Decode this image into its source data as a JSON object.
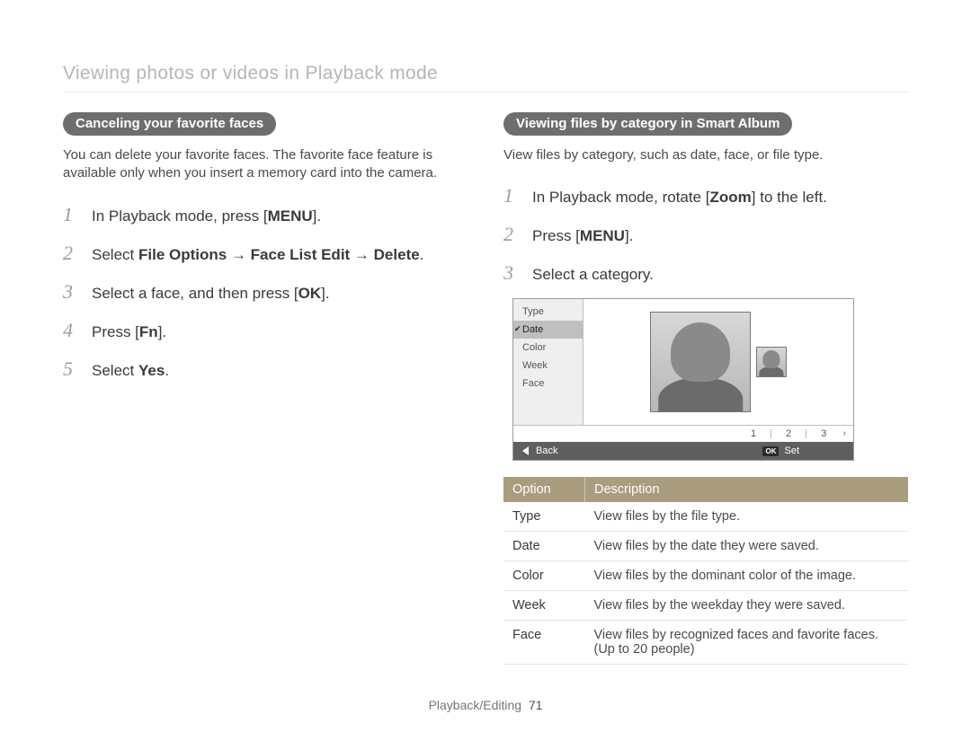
{
  "page_title": "Viewing photos or videos in Playback mode",
  "left": {
    "heading": "Canceling your favorite faces",
    "intro": "You can delete your favorite faces. The favorite face feature is available only when you insert a memory card into the camera.",
    "steps": {
      "s1_a": "In Playback mode, press [",
      "s1_btn": "MENU",
      "s1_b": "].",
      "s2_a": "Select ",
      "s2_b1": "File Options",
      "s2_arrow1": " → ",
      "s2_b2": "Face List Edit",
      "s2_arrow2": " → ",
      "s2_b3": "Delete",
      "s2_c": ".",
      "s3_a": "Select a face, and then press [",
      "s3_btn": "OK",
      "s3_b": "].",
      "s4_a": "Press [",
      "s4_btn": "Fn",
      "s4_b": "].",
      "s5_a": "Select ",
      "s5_b": "Yes",
      "s5_c": "."
    }
  },
  "right": {
    "heading": "Viewing files by category in Smart Album",
    "intro": "View files by category, such as date, face, or file type.",
    "steps": {
      "s1_a": "In Playback mode, rotate [",
      "s1_btn": "Zoom",
      "s1_b": "] to the left.",
      "s2_a": "Press [",
      "s2_btn": "MENU",
      "s2_b": "].",
      "s3": "Select a category."
    },
    "screen": {
      "side": [
        "Type",
        "Date",
        "Color",
        "Week",
        "Face"
      ],
      "nums": [
        "1",
        "2",
        "3"
      ],
      "back": "Back",
      "set": "Set",
      "ok": "OK"
    },
    "table": {
      "h1": "Option",
      "h2": "Description",
      "rows": [
        {
          "opt": "Type",
          "desc": "View files by the file type."
        },
        {
          "opt": "Date",
          "desc": "View files by the date they were saved."
        },
        {
          "opt": "Color",
          "desc": "View files by the dominant color of the image."
        },
        {
          "opt": "Week",
          "desc": "View files by the weekday they were saved."
        },
        {
          "opt": "Face",
          "desc": "View files by recognized faces and favorite faces. (Up to 20 people)"
        }
      ]
    }
  },
  "footer": {
    "section": "Playback/Editing",
    "page": "71"
  }
}
